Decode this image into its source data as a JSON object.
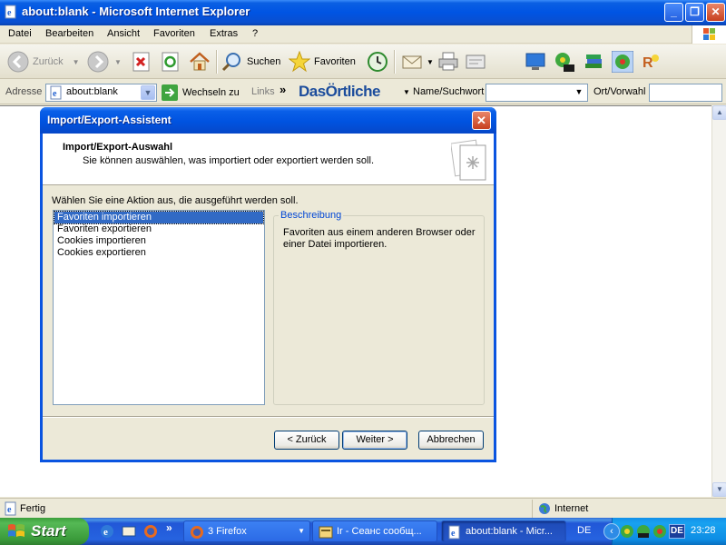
{
  "window": {
    "title": "about:blank - Microsoft Internet Explorer",
    "controls": {
      "minimize": "_",
      "maximize": "❐",
      "close": "✕"
    }
  },
  "menubar": {
    "items": [
      "Datei",
      "Bearbeiten",
      "Ansicht",
      "Favoriten",
      "Extras",
      "?"
    ]
  },
  "toolbar": {
    "back_label": "Zurück",
    "search_label": "Suchen",
    "favorites_label": "Favoriten"
  },
  "addressbar": {
    "label": "Adresse",
    "url": "about:blank",
    "go_label": "Wechseln zu",
    "links_label": "Links",
    "links_chevron": "»",
    "brand": "DasÖrtliche",
    "name_label": "Name/Suchwort",
    "location_label": "Ort/Vorwahl"
  },
  "statusbar": {
    "status": "Fertig",
    "zone": "Internet"
  },
  "dialog": {
    "title": "Import/Export-Assistent",
    "close_symbol": "✕",
    "header_title": "Import/Export-Auswahl",
    "header_subtitle": "Sie können auswählen, was importiert oder exportiert werden soll.",
    "prompt": "Wählen Sie eine Aktion aus, die ausgeführt werden soll.",
    "actions": [
      "Favoriten importieren",
      "Favoriten exportieren",
      "Cookies importieren",
      "Cookies exportieren"
    ],
    "selected_action": "Favoriten importieren",
    "description_legend": "Beschreibung",
    "description_text": "Favoriten aus einem anderen Browser oder einer Datei importieren.",
    "buttons": {
      "back": "< Zurück",
      "next": "Weiter >",
      "cancel": "Abbrechen"
    }
  },
  "taskbar": {
    "start_label": "Start",
    "quicklaunch_chevron": "»",
    "tasks": [
      {
        "label": "3 Firefox",
        "active": false
      },
      {
        "label": "Ir - Сеанс сообщ...",
        "active": false
      },
      {
        "label": "about:blank - Micr...",
        "active": true
      }
    ],
    "language": "DE",
    "tray_language": "DE",
    "clock": "23:28"
  },
  "colors": {
    "xp_blue": "#0054E3",
    "selection": "#316AC5",
    "start_green": "#3C9E3C",
    "groupbox_title": "#0046D5"
  }
}
